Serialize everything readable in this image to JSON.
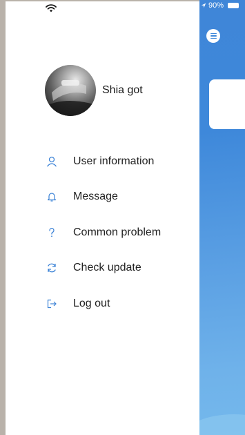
{
  "status": {
    "battery": "90%"
  },
  "profile": {
    "name": "Shia got"
  },
  "menu": {
    "items": [
      {
        "label": "User information",
        "icon": "user-icon"
      },
      {
        "label": "Message",
        "icon": "bell-icon"
      },
      {
        "label": "Common problem",
        "icon": "question-icon"
      },
      {
        "label": "Check update",
        "icon": "refresh-icon"
      },
      {
        "label": "Log out",
        "icon": "logout-icon"
      }
    ]
  },
  "colors": {
    "accent": "#3e88da",
    "icon": "#3b82d6"
  }
}
